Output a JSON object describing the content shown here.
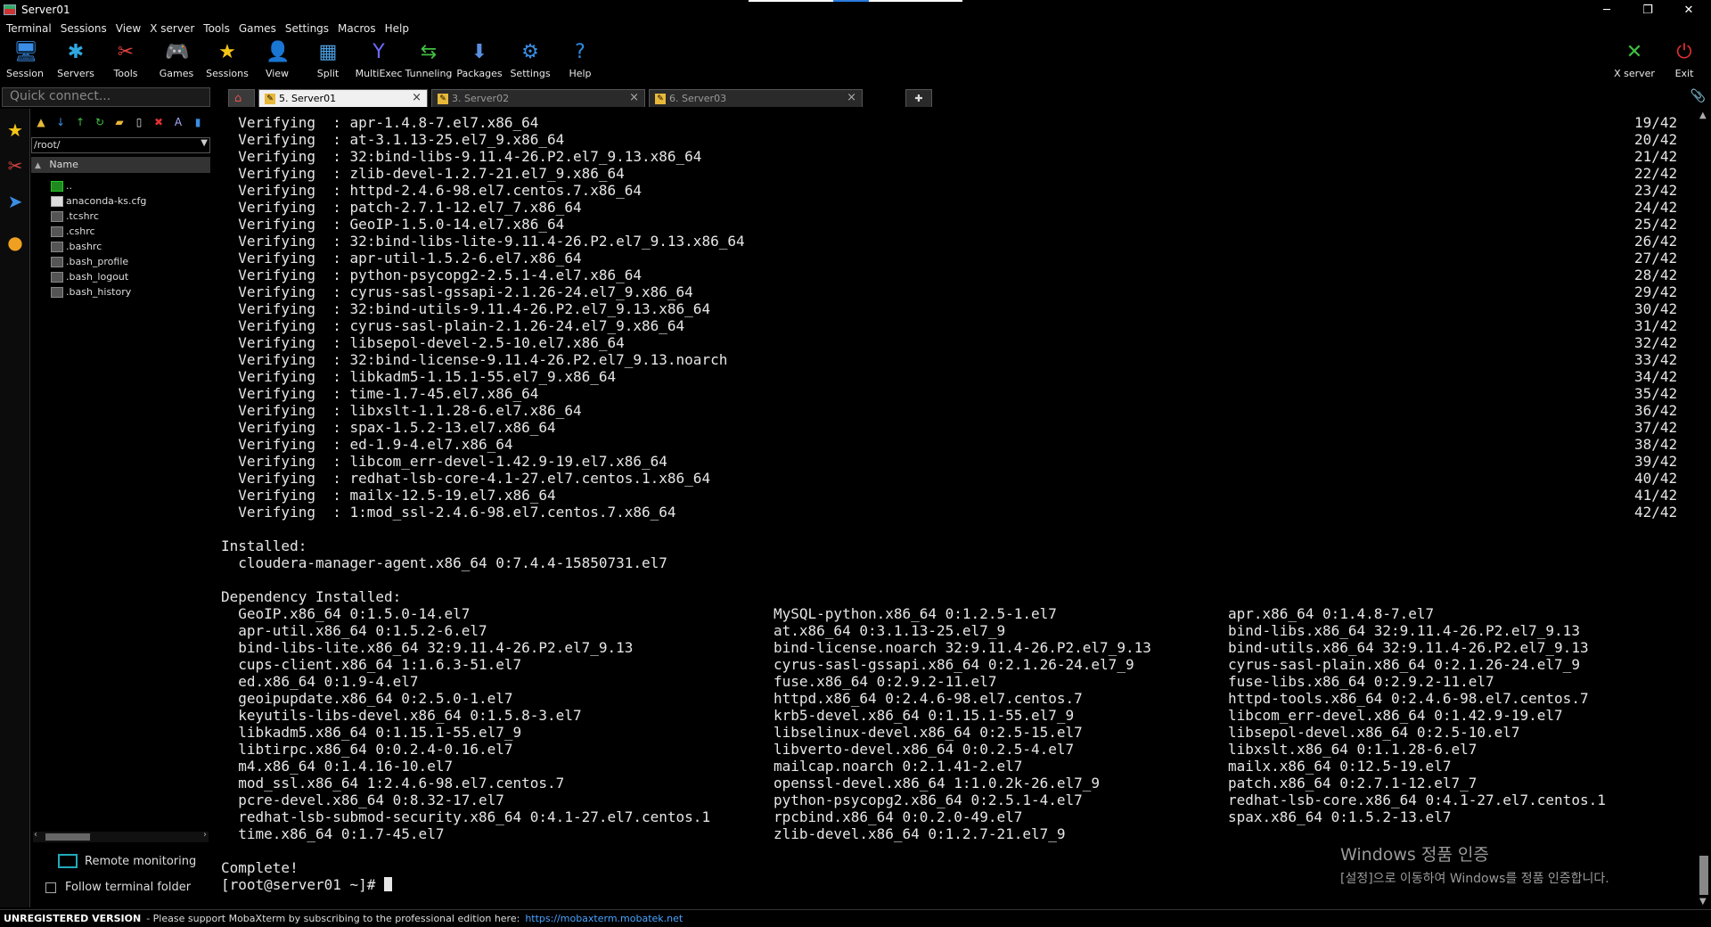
{
  "window": {
    "title": "Server01"
  },
  "menu": [
    "Terminal",
    "Sessions",
    "View",
    "X server",
    "Tools",
    "Games",
    "Settings",
    "Macros",
    "Help"
  ],
  "toolbar": {
    "left": [
      {
        "label": "Session",
        "icon": "session-icon",
        "glyph": "🖥",
        "color": "#3a8ee6"
      },
      {
        "label": "Servers",
        "icon": "servers-icon",
        "glyph": "✱",
        "color": "#2fa8e0"
      },
      {
        "label": "Tools",
        "icon": "tools-icon",
        "glyph": "✂",
        "color": "#e04040"
      },
      {
        "label": "Games",
        "icon": "games-icon",
        "glyph": "🎮",
        "color": "#cccccc"
      },
      {
        "label": "Sessions",
        "icon": "sessions-star-icon",
        "glyph": "★",
        "color": "#f5c518"
      },
      {
        "label": "View",
        "icon": "view-icon",
        "glyph": "👤",
        "color": "#88aacc"
      },
      {
        "label": "Split",
        "icon": "split-icon",
        "glyph": "▦",
        "color": "#4a9de0"
      },
      {
        "label": "MultiExec",
        "icon": "multiexec-icon",
        "glyph": "Y",
        "color": "#6a6aff"
      },
      {
        "label": "Tunneling",
        "icon": "tunneling-icon",
        "glyph": "⇆",
        "color": "#40c040"
      },
      {
        "label": "Packages",
        "icon": "packages-icon",
        "glyph": "⬇",
        "color": "#5a8ee0"
      },
      {
        "label": "Settings",
        "icon": "settings-gear-icon",
        "glyph": "⚙",
        "color": "#3a8ee6"
      },
      {
        "label": "Help",
        "icon": "help-icon",
        "glyph": "?",
        "color": "#2f8de4"
      }
    ],
    "right": [
      {
        "label": "X server",
        "icon": "xserver-icon",
        "glyph": "✕",
        "color": "#40c040"
      },
      {
        "label": "Exit",
        "icon": "exit-power-icon",
        "glyph": "⏻",
        "color": "#e03030"
      }
    ]
  },
  "quick_connect": {
    "placeholder": "Quick connect..."
  },
  "tabs": [
    {
      "label": "5. Server01",
      "active": true
    },
    {
      "label": "3. Server02",
      "active": false
    },
    {
      "label": "6. Server03",
      "active": false
    }
  ],
  "sidebar": {
    "path": "/root/",
    "column": "Name",
    "files": [
      "..",
      "anaconda-ks.cfg",
      ".tcshrc",
      ".cshrc",
      ".bashrc",
      ".bash_profile",
      ".bash_logout",
      ".bash_history"
    ],
    "remote_monitoring": "Remote monitoring",
    "follow_terminal": "Follow terminal folder"
  },
  "terminal": {
    "verifying": [
      {
        "text": "  Verifying  : apr-1.4.8-7.el7.x86_64",
        "count": "19/42"
      },
      {
        "text": "  Verifying  : at-3.1.13-25.el7_9.x86_64",
        "count": "20/42"
      },
      {
        "text": "  Verifying  : 32:bind-libs-9.11.4-26.P2.el7_9.13.x86_64",
        "count": "21/42"
      },
      {
        "text": "  Verifying  : zlib-devel-1.2.7-21.el7_9.x86_64",
        "count": "22/42"
      },
      {
        "text": "  Verifying  : httpd-2.4.6-98.el7.centos.7.x86_64",
        "count": "23/42"
      },
      {
        "text": "  Verifying  : patch-2.7.1-12.el7_7.x86_64",
        "count": "24/42"
      },
      {
        "text": "  Verifying  : GeoIP-1.5.0-14.el7.x86_64",
        "count": "25/42"
      },
      {
        "text": "  Verifying  : 32:bind-libs-lite-9.11.4-26.P2.el7_9.13.x86_64",
        "count": "26/42"
      },
      {
        "text": "  Verifying  : apr-util-1.5.2-6.el7.x86_64",
        "count": "27/42"
      },
      {
        "text": "  Verifying  : python-psycopg2-2.5.1-4.el7.x86_64",
        "count": "28/42"
      },
      {
        "text": "  Verifying  : cyrus-sasl-gssapi-2.1.26-24.el7_9.x86_64",
        "count": "29/42"
      },
      {
        "text": "  Verifying  : 32:bind-utils-9.11.4-26.P2.el7_9.13.x86_64",
        "count": "30/42"
      },
      {
        "text": "  Verifying  : cyrus-sasl-plain-2.1.26-24.el7_9.x86_64",
        "count": "31/42"
      },
      {
        "text": "  Verifying  : libsepol-devel-2.5-10.el7.x86_64",
        "count": "32/42"
      },
      {
        "text": "  Verifying  : 32:bind-license-9.11.4-26.P2.el7_9.13.noarch",
        "count": "33/42"
      },
      {
        "text": "  Verifying  : libkadm5-1.15.1-55.el7_9.x86_64",
        "count": "34/42"
      },
      {
        "text": "  Verifying  : time-1.7-45.el7.x86_64",
        "count": "35/42"
      },
      {
        "text": "  Verifying  : libxslt-1.1.28-6.el7.x86_64",
        "count": "36/42"
      },
      {
        "text": "  Verifying  : spax-1.5.2-13.el7.x86_64",
        "count": "37/42"
      },
      {
        "text": "  Verifying  : ed-1.9-4.el7.x86_64",
        "count": "38/42"
      },
      {
        "text": "  Verifying  : libcom_err-devel-1.42.9-19.el7.x86_64",
        "count": "39/42"
      },
      {
        "text": "  Verifying  : redhat-lsb-core-4.1-27.el7.centos.1.x86_64",
        "count": "40/42"
      },
      {
        "text": "  Verifying  : mailx-12.5-19.el7.x86_64",
        "count": "41/42"
      },
      {
        "text": "  Verifying  : 1:mod_ssl-2.4.6-98.el7.centos.7.x86_64",
        "count": "42/42"
      }
    ],
    "installed_header": "Installed:",
    "installed": "  cloudera-manager-agent.x86_64 0:7.4.4-15850731.el7",
    "dependency_header": "Dependency Installed:",
    "dependencies": [
      [
        "  GeoIP.x86_64 0:1.5.0-14.el7",
        "MySQL-python.x86_64 0:1.2.5-1.el7",
        "apr.x86_64 0:1.4.8-7.el7"
      ],
      [
        "  apr-util.x86_64 0:1.5.2-6.el7",
        "at.x86_64 0:3.1.13-25.el7_9",
        "bind-libs.x86_64 32:9.11.4-26.P2.el7_9.13"
      ],
      [
        "  bind-libs-lite.x86_64 32:9.11.4-26.P2.el7_9.13",
        "bind-license.noarch 32:9.11.4-26.P2.el7_9.13",
        "bind-utils.x86_64 32:9.11.4-26.P2.el7_9.13"
      ],
      [
        "  cups-client.x86_64 1:1.6.3-51.el7",
        "cyrus-sasl-gssapi.x86_64 0:2.1.26-24.el7_9",
        "cyrus-sasl-plain.x86_64 0:2.1.26-24.el7_9"
      ],
      [
        "  ed.x86_64 0:1.9-4.el7",
        "fuse.x86_64 0:2.9.2-11.el7",
        "fuse-libs.x86_64 0:2.9.2-11.el7"
      ],
      [
        "  geoipupdate.x86_64 0:2.5.0-1.el7",
        "httpd.x86_64 0:2.4.6-98.el7.centos.7",
        "httpd-tools.x86_64 0:2.4.6-98.el7.centos.7"
      ],
      [
        "  keyutils-libs-devel.x86_64 0:1.5.8-3.el7",
        "krb5-devel.x86_64 0:1.15.1-55.el7_9",
        "libcom_err-devel.x86_64 0:1.42.9-19.el7"
      ],
      [
        "  libkadm5.x86_64 0:1.15.1-55.el7_9",
        "libselinux-devel.x86_64 0:2.5-15.el7",
        "libsepol-devel.x86_64 0:2.5-10.el7"
      ],
      [
        "  libtirpc.x86_64 0:0.2.4-0.16.el7",
        "libverto-devel.x86_64 0:0.2.5-4.el7",
        "libxslt.x86_64 0:1.1.28-6.el7"
      ],
      [
        "  m4.x86_64 0:1.4.16-10.el7",
        "mailcap.noarch 0:2.1.41-2.el7",
        "mailx.x86_64 0:12.5-19.el7"
      ],
      [
        "  mod_ssl.x86_64 1:2.4.6-98.el7.centos.7",
        "openssl-devel.x86_64 1:1.0.2k-26.el7_9",
        "patch.x86_64 0:2.7.1-12.el7_7"
      ],
      [
        "  pcre-devel.x86_64 0:8.32-17.el7",
        "python-psycopg2.x86_64 0:2.5.1-4.el7",
        "redhat-lsb-core.x86_64 0:4.1-27.el7.centos.1"
      ],
      [
        "  redhat-lsb-submod-security.x86_64 0:4.1-27.el7.centos.1",
        "rpcbind.x86_64 0:0.2.0-49.el7",
        "spax.x86_64 0:1.5.2-13.el7"
      ],
      [
        "  time.x86_64 0:1.7-45.el7",
        "zlib-devel.x86_64 0:1.2.7-21.el7_9",
        ""
      ]
    ],
    "complete": "Complete!",
    "prompt": "[root@server01 ~]# "
  },
  "watermark": {
    "line1": "Windows 정품 인증",
    "line2": "[설정]으로 이동하여 Windows를 정품 인증합니다."
  },
  "status": {
    "unregistered": "UNREGISTERED VERSION",
    "message": " -  Please support MobaXterm by subscribing to the professional edition here:",
    "link": "https://mobaxterm.mobatek.net"
  }
}
